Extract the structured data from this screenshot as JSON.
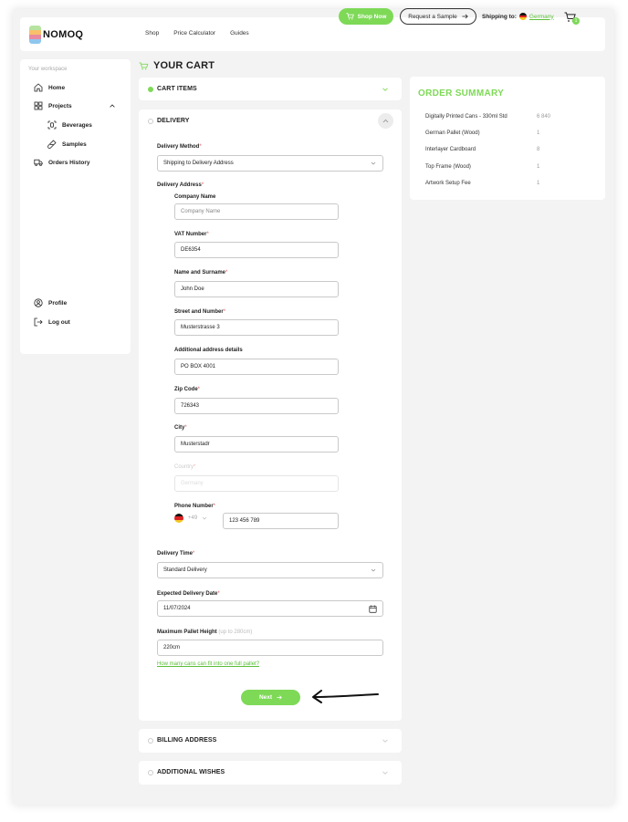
{
  "brand": {
    "name": "NOMOQ"
  },
  "nav": {
    "items": [
      "Shop",
      "Price Calculator",
      "Guides"
    ]
  },
  "header": {
    "shop_now": "Shop Now",
    "request_sample": "Request a Sample",
    "shipping_label": "Shipping to:",
    "shipping_country": "Germany",
    "cart_count": "1"
  },
  "sidebar": {
    "workspace_label": "Your workspace",
    "home": "Home",
    "projects": "Projects",
    "beverages": "Beverages",
    "samples": "Samples",
    "orders_history": "Orders History",
    "profile": "Profile",
    "log_out": "Log out"
  },
  "page": {
    "title": "YOUR CART"
  },
  "sections": {
    "cart_items": "CART ITEMS",
    "delivery": "DELIVERY",
    "billing_address": "BILLING ADDRESS",
    "additional_wishes": "ADDITIONAL WISHES"
  },
  "form": {
    "delivery_method_label": "Delivery Method",
    "delivery_method_value": "Shipping to Delivery Address",
    "delivery_address_label": "Delivery Address",
    "company_name_label": "Company Name",
    "company_name_placeholder": "Company Name",
    "vat_label": "VAT Number",
    "vat_value": "DE6354",
    "name_label": "Name and Surname",
    "name_value": "John Doe",
    "street_label": "Street and Number",
    "street_value": "Musterstrasse 3",
    "additional_label": "Additional address details",
    "additional_value": "PO BOX 4001",
    "zip_label": "Zip Code",
    "zip_value": "726343",
    "city_label": "City",
    "city_value": "Musterstadr",
    "country_label": "Country",
    "country_value": "Germany",
    "phone_label": "Phone Number",
    "phone_code": "+49",
    "phone_value": "123 456 789",
    "delivery_time_label": "Delivery Time",
    "delivery_time_value": "Standard Delivery",
    "expected_date_label": "Expected Delivery Date",
    "expected_date_value": "11/07/2024",
    "pallet_height_label": "Maximum Pallet Height",
    "pallet_height_hint": "(up to 280cm)",
    "pallet_height_value": "220cm",
    "cans_link": "How many cans can fit into one full pallet?",
    "next_button": "Next",
    "required_mark": "*"
  },
  "summary": {
    "title": "ORDER SUMMARY",
    "rows": [
      {
        "name": "Digitally Printed Cans - 330ml Std",
        "qty": "6 840"
      },
      {
        "name": "German Pallet (Wood)",
        "qty": "1"
      },
      {
        "name": "Interlayer Cardboard",
        "qty": "8"
      },
      {
        "name": "Top Frame (Wood)",
        "qty": "1"
      },
      {
        "name": "Artwork Setup Fee",
        "qty": "1"
      }
    ]
  },
  "colors": {
    "accent": "#7ed957",
    "link": "#5cbf3a",
    "required": "#e25a5a"
  }
}
